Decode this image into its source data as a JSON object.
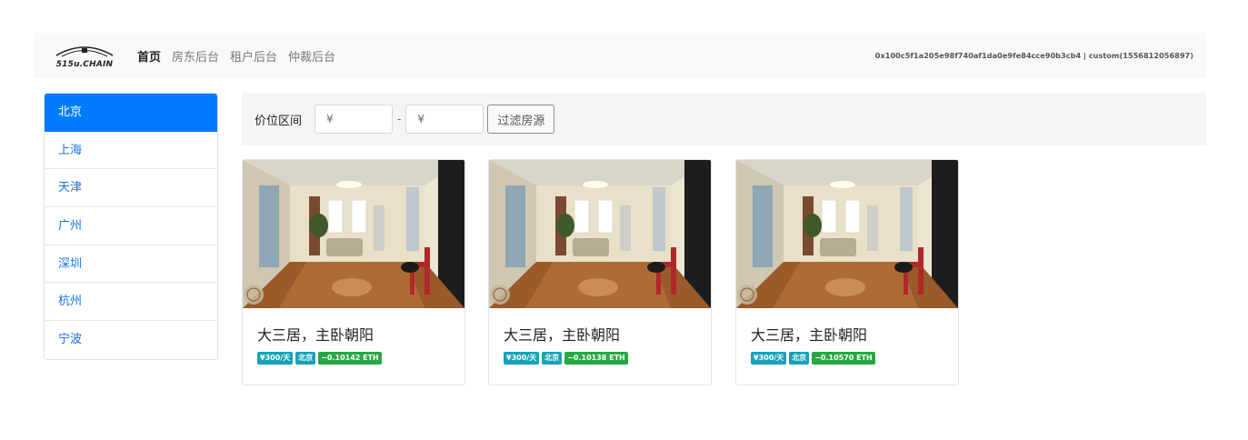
{
  "navbar": {
    "brand": "515u.CHAIN",
    "links": [
      "首页",
      "房东后台",
      "租户后台",
      "仲裁后台"
    ],
    "account": "0x100c5f1a205e98f740af1da0e9fe84cce90b3cb4 | custom(1556812056897)"
  },
  "sidebar": {
    "cities": [
      "北京",
      "上海",
      "天津",
      "广州",
      "深圳",
      "杭州",
      "宁波"
    ],
    "active": "北京"
  },
  "filter": {
    "label": "价位区间",
    "min_placeholder": "¥",
    "separator": "-",
    "max_placeholder": "¥",
    "button": "过滤房源"
  },
  "listings": [
    {
      "title": "大三居，主卧朝阳",
      "price": "¥300/天",
      "city": "北京",
      "eth": "−0.10142 ETH"
    },
    {
      "title": "大三居，主卧朝阳",
      "price": "¥300/天",
      "city": "北京",
      "eth": "−0.10138 ETH"
    },
    {
      "title": "大三居，主卧朝阳",
      "price": "¥300/天",
      "city": "北京",
      "eth": "−0.10570 ETH"
    }
  ],
  "colors": {
    "primary": "#007bff",
    "badge_info": "#17a2b8",
    "badge_success": "#28a745",
    "navbar_bg": "#f8f9fa"
  }
}
